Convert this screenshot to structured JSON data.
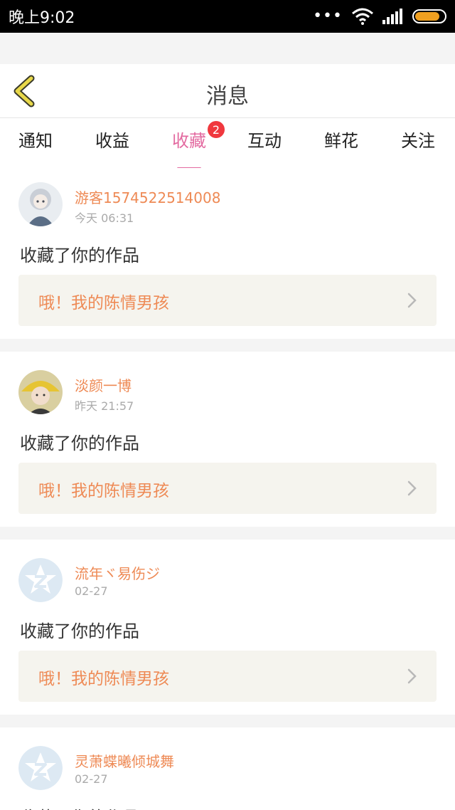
{
  "status_bar": {
    "time": "晚上9:02",
    "dots": "•••",
    "battery_level": 0.85,
    "battery_color": "#f0a020"
  },
  "header": {
    "title": "消息",
    "back_icon": "chevron-left-icon",
    "back_color": "#e8d84a"
  },
  "tabs": [
    {
      "label": "通知",
      "active": false
    },
    {
      "label": "收益",
      "active": false
    },
    {
      "label": "收藏",
      "active": true,
      "badge": "2"
    },
    {
      "label": "互动",
      "active": false
    },
    {
      "label": "鲜花",
      "active": false
    },
    {
      "label": "关注",
      "active": false
    }
  ],
  "accent_color": "#e36aa0",
  "username_color": "#ee8a55",
  "messages": [
    {
      "username": "游客1574522514008",
      "time": "今天 06:31",
      "action": "收藏了你的作品",
      "work_title": "哦！我的陈情男孩",
      "avatar": "anime-girl-avatar"
    },
    {
      "username": "淡颜一博",
      "time": "昨天 21:57",
      "action": "收藏了你的作品",
      "work_title": "哦！我的陈情男孩",
      "avatar": "photo-avatar"
    },
    {
      "username": "流年ヾ易伤ジ",
      "time": "02-27",
      "action": "收藏了你的作品",
      "work_title": "哦！我的陈情男孩",
      "avatar": "qzone-default-avatar"
    },
    {
      "username": "灵萧蝶曦倾城舞",
      "time": "02-27",
      "action": "收藏了你的作品",
      "avatar": "qzone-default-avatar"
    }
  ]
}
